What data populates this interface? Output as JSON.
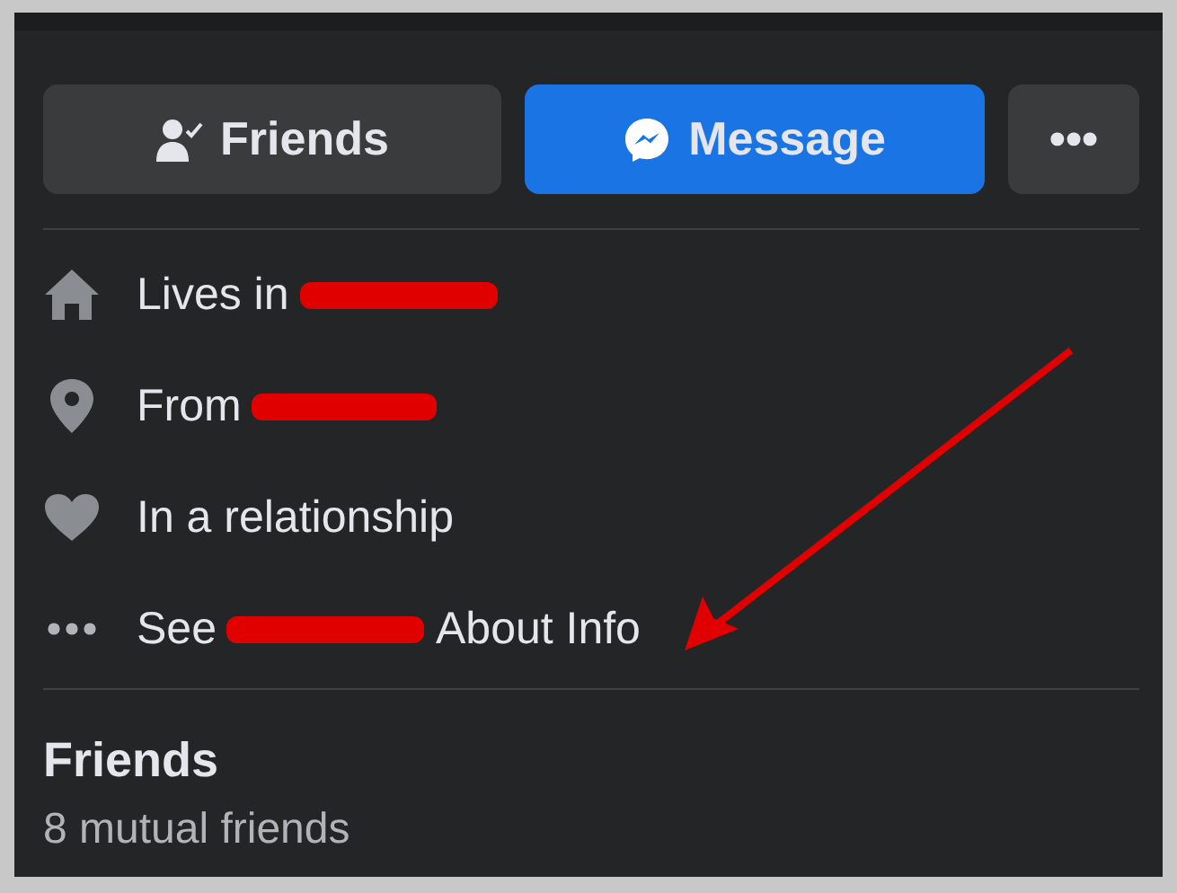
{
  "actions": [
    {
      "kind": "friends",
      "label": "Friends",
      "primary": false
    },
    {
      "kind": "message",
      "label": "Message",
      "primary": true
    },
    {
      "kind": "more",
      "label": "•••",
      "primary": false
    }
  ],
  "info": [
    {
      "kind": "home",
      "text": "Lives in",
      "redacted": true
    },
    {
      "kind": "pin",
      "text": "From",
      "redacted": true
    },
    {
      "kind": "heart",
      "text": "In a relationship",
      "redacted": false
    },
    {
      "kind": "dots",
      "text": "See",
      "redacted": true,
      "after": "About Info"
    }
  ],
  "friends": {
    "title": "Friends",
    "subtitle": "8 mutual friends"
  }
}
